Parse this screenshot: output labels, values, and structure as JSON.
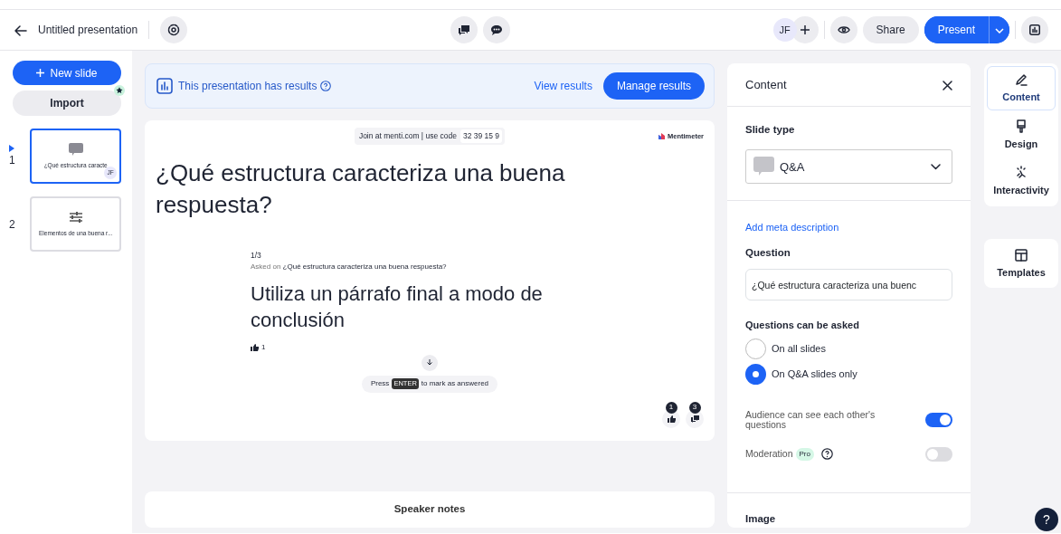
{
  "header": {
    "title": "Untitled presentation",
    "avatar": "JF",
    "share": "Share",
    "present": "Present"
  },
  "sidebar": {
    "new_slide": "New slide",
    "import": "Import",
    "slides": [
      {
        "number": "1",
        "caption": "¿Qué estructura caracte",
        "selected": true,
        "kind": "qa",
        "avatar": "JF"
      },
      {
        "number": "2",
        "caption": "Elementos de una buena r...",
        "selected": false,
        "kind": "scale"
      }
    ]
  },
  "banner": {
    "text": "This presentation has results",
    "view": "View results",
    "manage": "Manage results"
  },
  "slide": {
    "join": "Join at menti.com | use code",
    "code": "32 39 15 9",
    "brand": "Mentimeter",
    "title": "¿Qué estructura caracteriza una buena respuesta?",
    "counter": "1/3",
    "asked_prefix": "Asked on",
    "asked_question": "¿Qué estructura caracteriza una buena respuesta?",
    "answer": "Utiliza un párrafo final a modo de conclusión",
    "likes": "1",
    "hint_before": "Press",
    "hint_key": "ENTER",
    "hint_after": "to mark as answered",
    "like_count": "1",
    "question_count": "3"
  },
  "speaker_notes": "Speaker notes",
  "panel": {
    "title": "Content",
    "slide_type_label": "Slide type",
    "slide_type": "Q&A",
    "meta_link": "Add meta description",
    "question_label": "Question",
    "question_value": "¿Qué estructura caracteriza una buenc",
    "asked_label": "Questions can be asked",
    "options": [
      {
        "label": "On all slides",
        "selected": false
      },
      {
        "label": "On Q&A slides only",
        "selected": true
      }
    ],
    "toggles": [
      {
        "label": "Audience can see each other's questions",
        "on": true
      },
      {
        "label": "Moderation",
        "on": false,
        "badge": "Pro"
      }
    ],
    "image_label": "Image"
  },
  "rail": [
    {
      "label": "Content",
      "selected": true,
      "kind": "pen"
    },
    {
      "label": "Design",
      "selected": false,
      "kind": "brush"
    },
    {
      "label": "Interactivity",
      "selected": false,
      "kind": "spark"
    },
    {
      "label": "Templates",
      "selected": false,
      "kind": "grid"
    }
  ],
  "help": "?"
}
